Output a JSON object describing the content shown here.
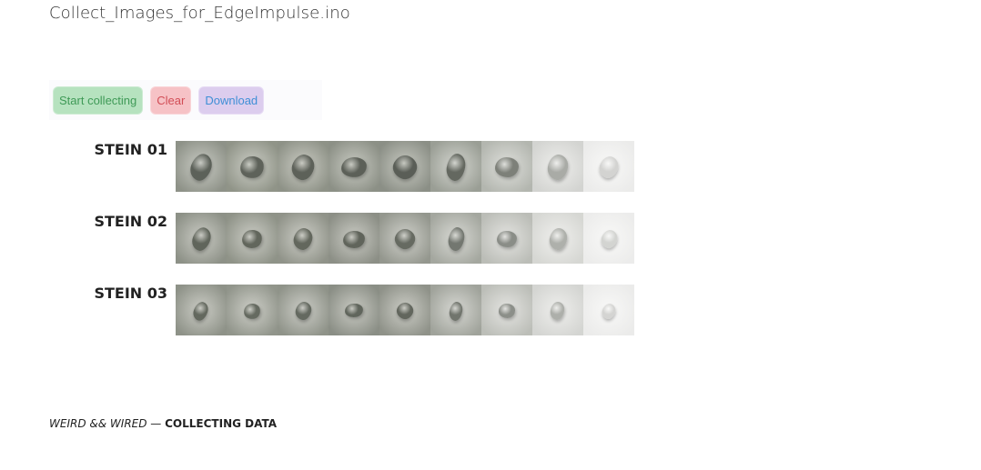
{
  "app": {
    "title": "Collect_Images_for_EdgeImpulse.ino"
  },
  "toolbar": {
    "start_label": "Start collecting",
    "clear_label": "Clear",
    "download_label": "Download"
  },
  "rows": [
    {
      "label": "STEIN 01",
      "thumbs": [
        {
          "bg": "#8e9288",
          "stone": "#5c6159",
          "glow": "#c9cbc4"
        },
        {
          "bg": "#909488",
          "stone": "#5e625a",
          "glow": "#cbcdc5"
        },
        {
          "bg": "#8e9287",
          "stone": "#5d6159",
          "glow": "#cacbc3"
        },
        {
          "bg": "#8c9086",
          "stone": "#5c6058",
          "glow": "#c8cac2"
        },
        {
          "bg": "#8b8f86",
          "stone": "#5a5e57",
          "glow": "#c7c9c1"
        },
        {
          "bg": "#9a9e95",
          "stone": "#646860",
          "glow": "#d3d5cf"
        },
        {
          "bg": "#b3b6af",
          "stone": "#7d8079",
          "glow": "#dedfdb"
        },
        {
          "bg": "#d3d4d1",
          "stone": "#a9aba6",
          "glow": "#eeeeec"
        },
        {
          "bg": "#ebebea",
          "stone": "#d3d3d1",
          "glow": "#f8f8f7"
        }
      ]
    },
    {
      "label": "STEIN 02",
      "thumbs": [
        {
          "bg": "#8d9187",
          "stone": "#60655b",
          "glow": "#cacbc4"
        },
        {
          "bg": "#8f9388",
          "stone": "#62665c",
          "glow": "#cbccc5"
        },
        {
          "bg": "#909389",
          "stone": "#63675d",
          "glow": "#cccdc6"
        },
        {
          "bg": "#8c8f86",
          "stone": "#60645b",
          "glow": "#c9cac3"
        },
        {
          "bg": "#94978e",
          "stone": "#666a61",
          "glow": "#cfd0ca"
        },
        {
          "bg": "#a4a79f",
          "stone": "#737770",
          "glow": "#d8d9d4"
        },
        {
          "bg": "#bbbdb7",
          "stone": "#8a8d87",
          "glow": "#e3e3e0"
        },
        {
          "bg": "#d6d7d3",
          "stone": "#aeb0ab",
          "glow": "#efefed"
        },
        {
          "bg": "#ececeb",
          "stone": "#d3d4d1",
          "glow": "#f8f8f7"
        }
      ]
    },
    {
      "label": "STEIN 03",
      "thumbs": [
        {
          "bg": "#8e9288",
          "stone": "#63685e",
          "glow": "#cbccc5"
        },
        {
          "bg": "#91958b",
          "stone": "#656a60",
          "glow": "#cdcec7"
        },
        {
          "bg": "#8f9389",
          "stone": "#646960",
          "glow": "#cbccc6"
        },
        {
          "bg": "#8a8e85",
          "stone": "#60655c",
          "glow": "#c8c9c2"
        },
        {
          "bg": "#8f9289",
          "stone": "#62665d",
          "glow": "#cbccc5"
        },
        {
          "bg": "#a0a39b",
          "stone": "#71756d",
          "glow": "#d6d7d2"
        },
        {
          "bg": "#bcbeb8",
          "stone": "#8c8f89",
          "glow": "#e4e4e1"
        },
        {
          "bg": "#d4d5d2",
          "stone": "#adafaa",
          "glow": "#eeeeec"
        },
        {
          "bg": "#ebebea",
          "stone": "#d4d4d2",
          "glow": "#f8f8f7"
        }
      ]
    }
  ],
  "footer": {
    "left": "WEIRD && WIRED",
    "separator": " — ",
    "right": "COLLECTING DATA"
  }
}
